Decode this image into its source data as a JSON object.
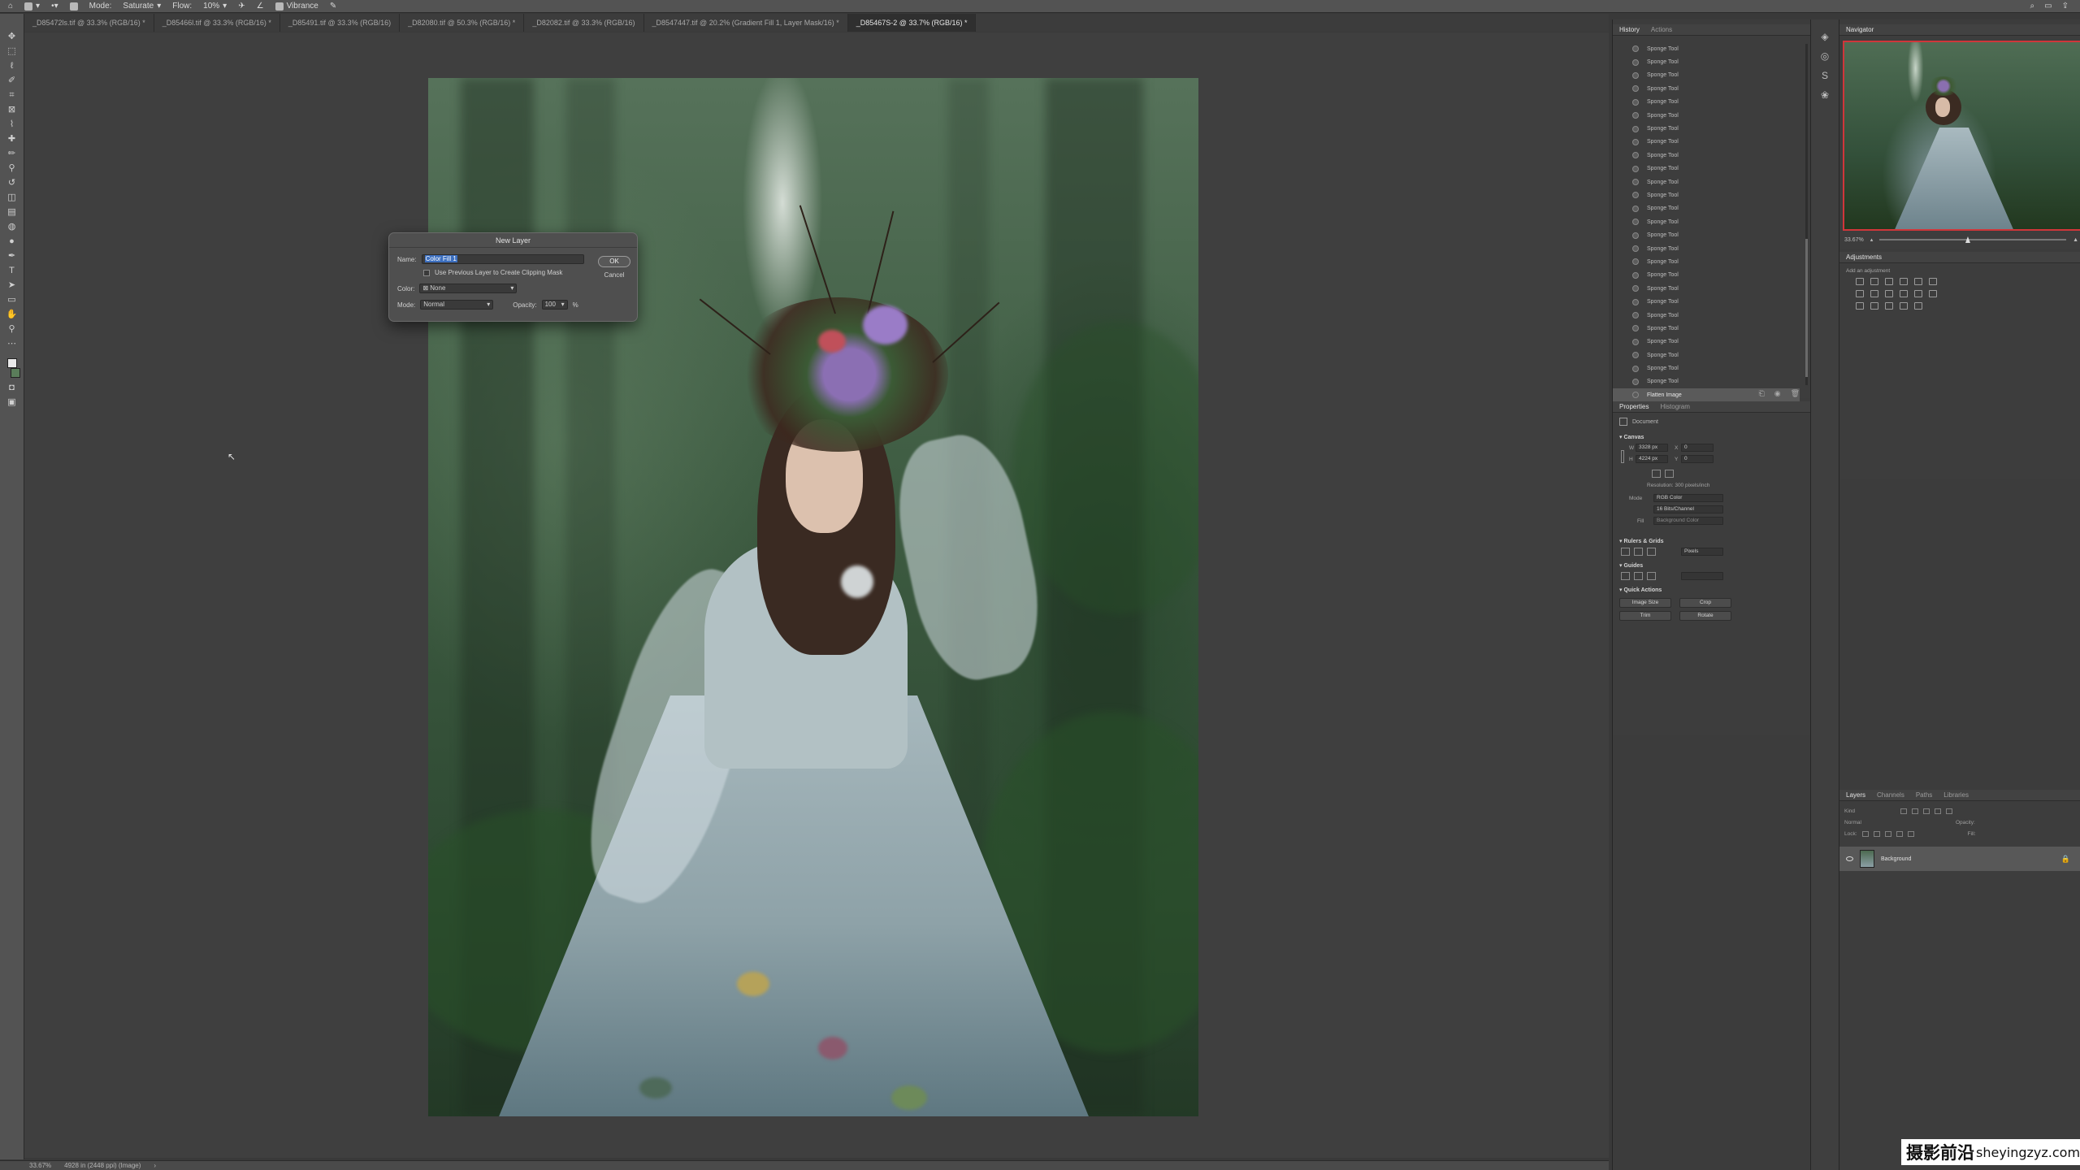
{
  "options_bar": {
    "items": [
      "Mode:",
      "Saturate",
      "Flow:",
      "10%",
      "Vibrance"
    ]
  },
  "doc_tabs": [
    "_D85472ls.tif @ 33.3% (RGB/16) *",
    "_D85466l.tif @ 33.3% (RGB/16) *",
    "_D85491.tif @ 33.3% (RGB/16)",
    "_D82080.tif @ 50.3% (RGB/16) *",
    "_D82082.tif @ 33.3% (RGB/16)",
    "_D8547447.tif @ 20.2% (Gradient Fill 1, Layer Mask/16) *",
    "_D85467S-2 @ 33.7% (RGB/16) *"
  ],
  "dialog": {
    "title": "New Layer",
    "name_label": "Name:",
    "name_value": "Color Fill 1",
    "checkbox_label": "Use Previous Layer to Create Clipping Mask",
    "color_label": "Color:",
    "color_value": "None",
    "mode_label": "Mode:",
    "mode_value": "Normal",
    "opacity_label": "Opacity:",
    "opacity_value": "100",
    "opacity_unit": "%",
    "ok_label": "OK",
    "cancel_label": "Cancel"
  },
  "status_bar": {
    "zoom": "33.67%",
    "doc_info": "4928 in (2448 ppi) (Image)"
  },
  "history": {
    "tabs": [
      "History",
      "Actions"
    ],
    "items": [
      "Sponge Tool",
      "Sponge Tool",
      "Sponge Tool",
      "Sponge Tool",
      "Sponge Tool",
      "Sponge Tool",
      "Sponge Tool",
      "Sponge Tool",
      "Sponge Tool",
      "Sponge Tool",
      "Sponge Tool",
      "Sponge Tool",
      "Sponge Tool",
      "Sponge Tool",
      "Sponge Tool",
      "Sponge Tool",
      "Sponge Tool",
      "Sponge Tool",
      "Sponge Tool",
      "Sponge Tool",
      "Sponge Tool",
      "Sponge Tool",
      "Sponge Tool",
      "Sponge Tool",
      "Sponge Tool",
      "Sponge Tool",
      "Flatten Image"
    ],
    "current_index": 26
  },
  "properties": {
    "tabs": [
      "Properties",
      "Histogram"
    ],
    "doc_label": "Document",
    "canvas_label": "Canvas",
    "w_label": "W",
    "w_value": "3328 px",
    "x_label": "X",
    "x_value": "0",
    "h_label": "H",
    "h_value": "4224 px",
    "y_label": "Y",
    "y_value": "0",
    "resolution": "Resolution: 300 pixels/inch",
    "mode_label": "Mode",
    "mode_value": "RGB Color",
    "bit_value": "16 Bits/Channel",
    "fill_label": "Fill",
    "fill_value": "Background Color",
    "rulers_label": "Rulers & Grids",
    "units_value": "Pixels",
    "guides_label": "Guides",
    "quick_actions_label": "Quick Actions",
    "buttons": [
      "Image Size",
      "Crop",
      "Trim",
      "Rotate"
    ]
  },
  "navigator": {
    "tab": "Navigator",
    "zoom": "33.67%"
  },
  "adjustments": {
    "tab": "Adjustments",
    "label": "Add an adjustment"
  },
  "layers": {
    "tabs": [
      "Layers",
      "Channels",
      "Paths",
      "Libraries"
    ],
    "kind_label": "Kind",
    "blend_label": "Normal",
    "opacity_label": "Opacity:",
    "lock_label": "Lock:",
    "fill_label": "Fill:",
    "layer_name": "Background"
  },
  "watermark": {
    "cn": "摄影前沿",
    "url": "sheyingzyz.com"
  }
}
